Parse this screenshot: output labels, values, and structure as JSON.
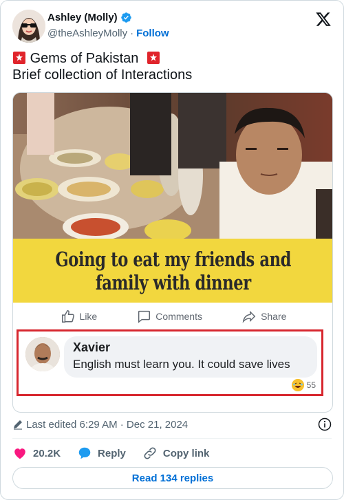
{
  "author": {
    "display_name": "Ashley (Molly)",
    "handle": "@theAshleyMolly",
    "separator": "·",
    "follow_label": "Follow",
    "verified_color": "#1d9bf0"
  },
  "tweet": {
    "line1_text": "Gems of Pakistan",
    "line2_text": "Brief collection of  Interactions",
    "emoji": "police-siren"
  },
  "media": {
    "caption_line1": "Going to eat my friends and",
    "caption_line2": "family with dinner",
    "actions": {
      "like": "Like",
      "comments": "Comments",
      "share": "Share"
    },
    "comment": {
      "name": "Xavier",
      "text": "English must learn you. It could save lives",
      "reaction_count": "55",
      "highlight_color": "#d7262e"
    }
  },
  "meta": {
    "edited_text": "Last edited 6:29 AM · Dec 21, 2024"
  },
  "actions": {
    "likes": "20.2K",
    "reply": "Reply",
    "copy_link": "Copy link"
  },
  "footer": {
    "read_replies": "Read 134 replies"
  },
  "colors": {
    "like_red": "#f91880",
    "reply_blue": "#1d9bf0",
    "link_blue": "#006fd6",
    "caption_yellow": "#f2d73e"
  }
}
